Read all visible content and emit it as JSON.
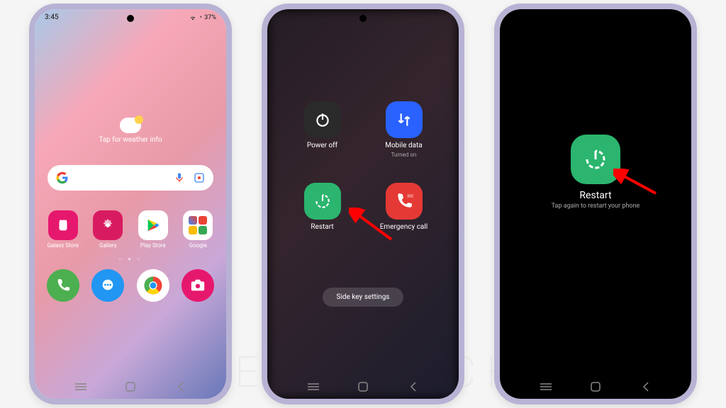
{
  "watermark": "SEBERTECH",
  "phone1": {
    "time": "3:45",
    "battery": "37%",
    "weather_tap": "Tap for weather info",
    "apps": {
      "galaxy": "Galaxy Store",
      "gallery": "Gallery",
      "play": "Play Store",
      "google": "Google"
    }
  },
  "phone2": {
    "power_off": "Power off",
    "mobile_data": "Mobile data",
    "mobile_data_sub": "Turned on",
    "restart": "Restart",
    "emergency": "Emergency call",
    "side_key": "Side key settings"
  },
  "phone3": {
    "restart": "Restart",
    "tap_again": "Tap again to restart your phone"
  }
}
